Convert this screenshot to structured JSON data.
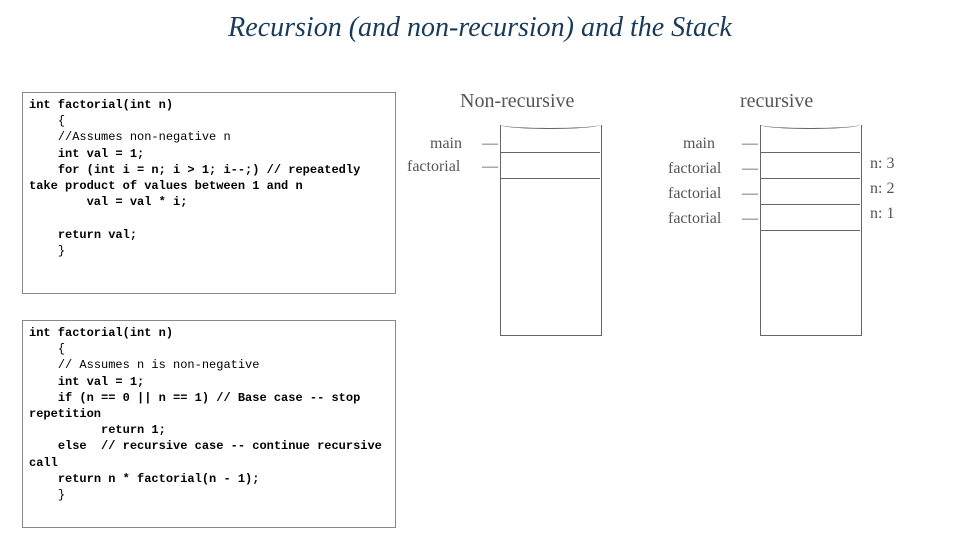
{
  "title": "Recursion (and non-recursion) and the Stack",
  "code1": {
    "l1": "int factorial(int n)",
    "l2": "    {",
    "l3": "    //Assumes non-negative n",
    "l4": "    int val = 1;",
    "l5a": "    for (int i = n; i > 1; i--;) ",
    "l5b": "// repeatedly take product of values between 1 and n",
    "l6": "        val = val * i;",
    "l7": "",
    "l8": "    return val;",
    "l9": "    }"
  },
  "code2": {
    "l1": "int factorial(int n)",
    "l2": "    {",
    "l3": "    // Assumes n is non-negative",
    "l4": "    int val = 1;",
    "l5a": "    if (n == 0 || n == 1) ",
    "l5b": "// Base case -- stop repetition",
    "l6": "          return 1;",
    "l7a": "    else  ",
    "l7b": "// recursive case -- continue recursive call",
    "l8": "    return n * factorial(n - 1);",
    "l9": "    }"
  },
  "sketch": {
    "left_title": "Non-recursive",
    "left_main": "main",
    "left_fact": "factorial",
    "right_title": "recursive",
    "right_main": "main",
    "right_f1": "factorial",
    "right_f2": "factorial",
    "right_f3": "factorial",
    "right_n3": "n: 3",
    "right_n2": "n: 2",
    "right_n1": "n: 1"
  }
}
